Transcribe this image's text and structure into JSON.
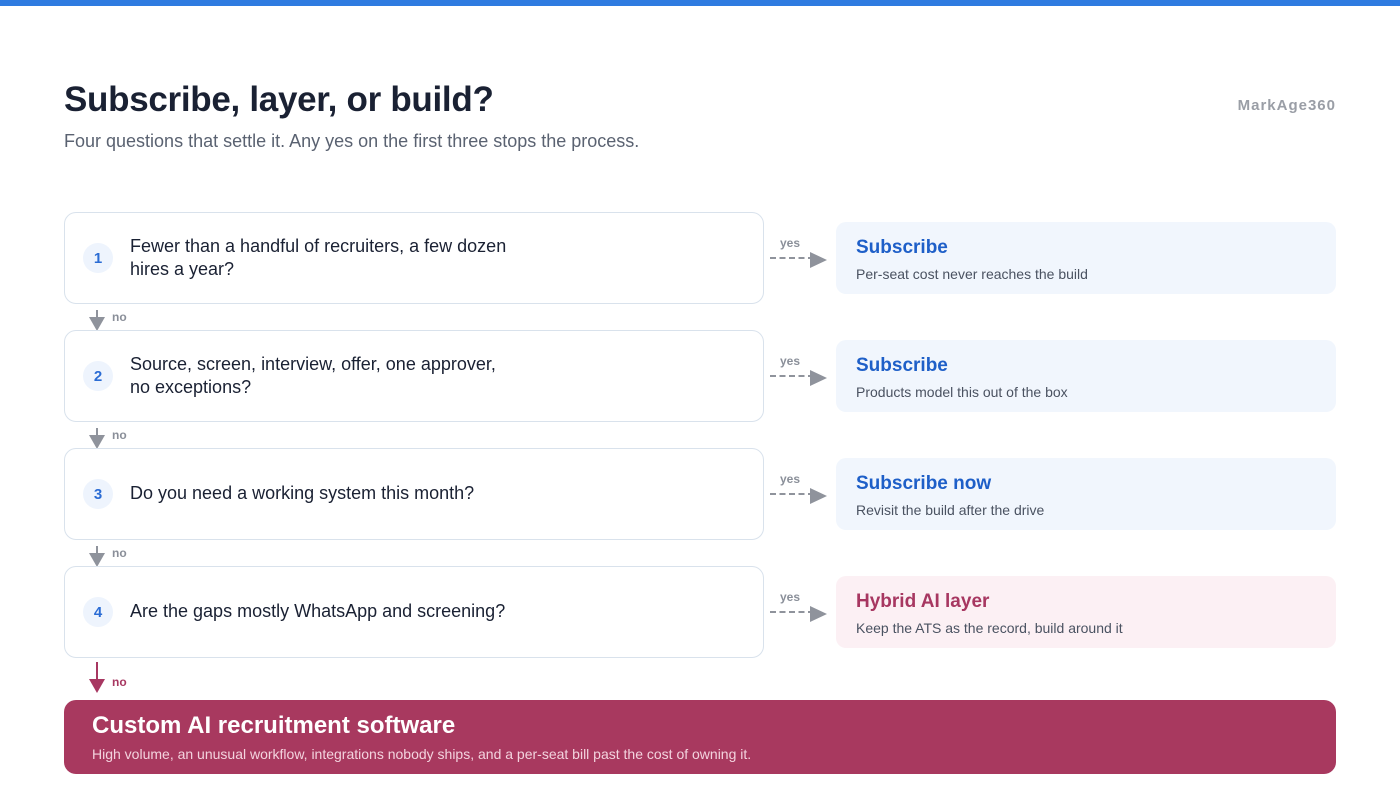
{
  "header": {
    "title": "Subscribe, layer, or build?",
    "subtitle": "Four questions that settle it. Any yes on the first three stops the process.",
    "brand": "MarkAge360"
  },
  "labels": {
    "yes": "yes",
    "no": "no"
  },
  "questions": [
    {
      "number": "1",
      "text": "Fewer than a handful of recruiters, a few dozen hires a year?",
      "result_title": "Subscribe",
      "result_desc": "Per-seat cost never reaches the build"
    },
    {
      "number": "2",
      "text": "Source, screen, interview, offer, one approver, no exceptions?",
      "result_title": "Subscribe",
      "result_desc": "Products model this out of the box"
    },
    {
      "number": "3",
      "text": "Do you need a working system this month?",
      "result_title": "Subscribe now",
      "result_desc": "Revisit the build after the drive"
    },
    {
      "number": "4",
      "text": "Are the gaps mostly WhatsApp and screening?",
      "result_title": "Hybrid AI layer",
      "result_desc": "Keep the ATS as the record, build around it"
    }
  ],
  "final": {
    "title": "Custom AI recruitment software",
    "desc": "High volume, an unusual workflow, integrations nobody ships, and a per-seat bill past the cost of owning it."
  },
  "colors": {
    "accent_bar": "#2f7be0",
    "subscribe": "#1e5fc8",
    "build": "#a8395f"
  }
}
